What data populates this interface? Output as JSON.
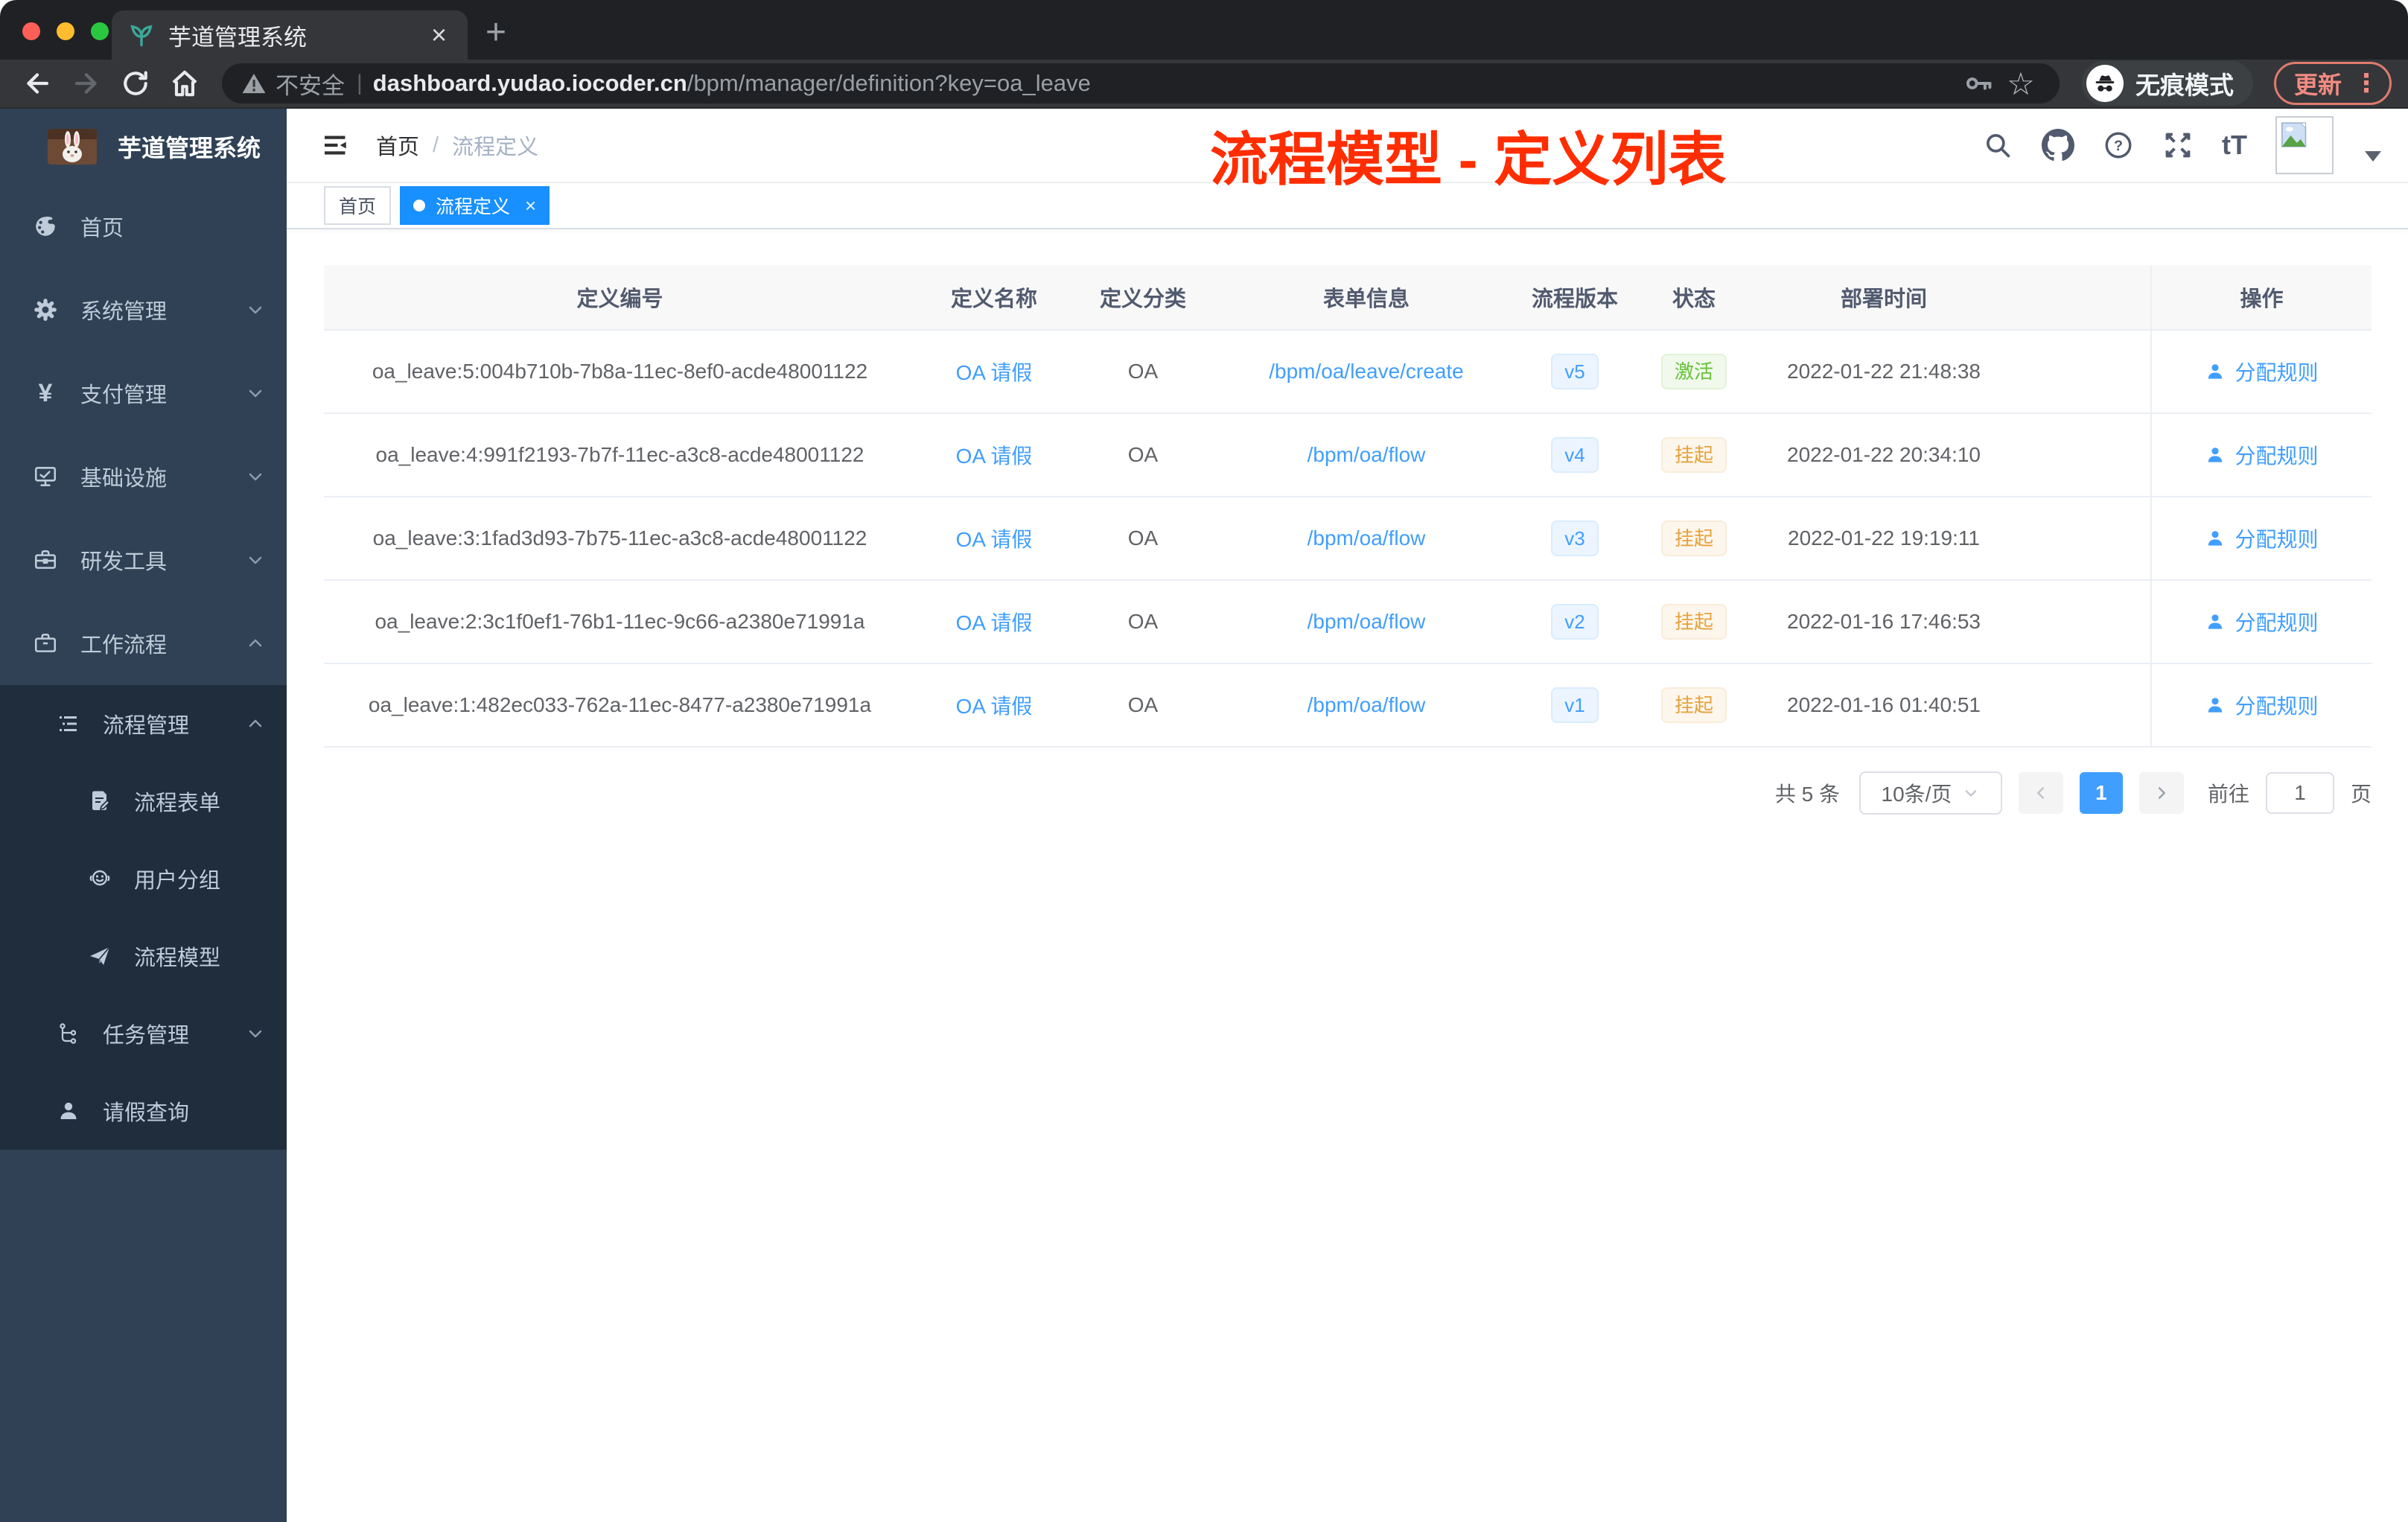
{
  "icons": {
    "close": "×",
    "plus": "+",
    "more": "⋮",
    "question": "?",
    "star": "☆",
    "tt": "tT",
    "yen": "¥"
  },
  "browser": {
    "tab_title": "芋道管理系统",
    "security_label": "不安全",
    "url_domain": "dashboard.yudao.iocoder.cn",
    "url_path": "/bpm/manager/definition?key=oa_leave",
    "incognito_label": "无痕模式",
    "update_label": "更新"
  },
  "sidebar": {
    "logo_title": "芋道管理系统",
    "items": [
      {
        "label": "首页"
      },
      {
        "label": "系统管理"
      },
      {
        "label": "支付管理"
      },
      {
        "label": "基础设施"
      },
      {
        "label": "研发工具"
      },
      {
        "label": "工作流程"
      }
    ],
    "submenu": [
      {
        "label": "流程管理"
      },
      {
        "label": "流程表单"
      },
      {
        "label": "用户分组"
      },
      {
        "label": "流程模型"
      },
      {
        "label": "任务管理"
      },
      {
        "label": "请假查询"
      }
    ]
  },
  "header": {
    "breadcrumb_home": "首页",
    "breadcrumb_sep": "/",
    "breadcrumb_current": "流程定义",
    "annotation": "流程模型 - 定义列表"
  },
  "tags": {
    "home": "首页",
    "active": "流程定义"
  },
  "table": {
    "headers": [
      "定义编号",
      "定义名称",
      "定义分类",
      "表单信息",
      "流程版本",
      "状态",
      "部署时间",
      "操作"
    ],
    "rows": [
      {
        "id": "oa_leave:5:004b710b-7b8a-11ec-8ef0-acde48001122",
        "name": "OA 请假",
        "category": "OA",
        "form": "/bpm/oa/leave/create",
        "version": "v5",
        "status": "激活",
        "time": "2022-01-22 21:48:38",
        "action": "分配规则"
      },
      {
        "id": "oa_leave:4:991f2193-7b7f-11ec-a3c8-acde48001122",
        "name": "OA 请假",
        "category": "OA",
        "form": "/bpm/oa/flow",
        "version": "v4",
        "status": "挂起",
        "time": "2022-01-22 20:34:10",
        "action": "分配规则"
      },
      {
        "id": "oa_leave:3:1fad3d93-7b75-11ec-a3c8-acde48001122",
        "name": "OA 请假",
        "category": "OA",
        "form": "/bpm/oa/flow",
        "version": "v3",
        "status": "挂起",
        "time": "2022-01-22 19:19:11",
        "action": "分配规则"
      },
      {
        "id": "oa_leave:2:3c1f0ef1-76b1-11ec-9c66-a2380e71991a",
        "name": "OA 请假",
        "category": "OA",
        "form": "/bpm/oa/flow",
        "version": "v2",
        "status": "挂起",
        "time": "2022-01-16 17:46:53",
        "action": "分配规则"
      },
      {
        "id": "oa_leave:1:482ec033-762a-11ec-8477-a2380e71991a",
        "name": "OA 请假",
        "category": "OA",
        "form": "/bpm/oa/flow",
        "version": "v1",
        "status": "挂起",
        "time": "2022-01-16 01:40:51",
        "action": "分配规则"
      }
    ]
  },
  "pagination": {
    "total": "共 5 条",
    "page_size": "10条/页",
    "page": "1",
    "goto_label": "前往",
    "goto_value": "1",
    "page_unit": "页"
  },
  "colors": {
    "accent": "#409eff",
    "tag_active": "#1890ff",
    "success": "#67c23a",
    "warning": "#e6a23c",
    "annotation": "#ff2d00",
    "sidebar": "#304156",
    "submenu": "#1f2d3d"
  }
}
